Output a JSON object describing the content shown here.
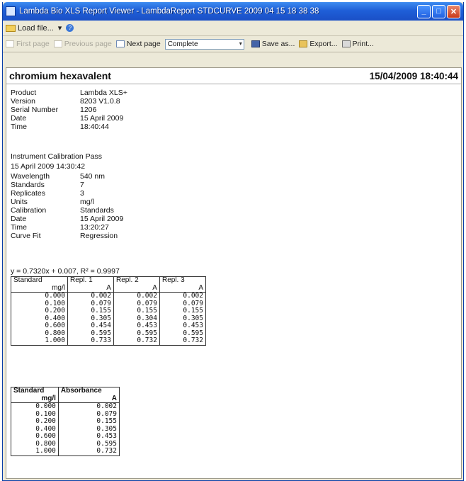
{
  "window": {
    "title": "Lambda Bio XLS Report Viewer - LambdaReport STDCURVE 2009 04 15 18 38 38",
    "min_glyph": "_",
    "max_glyph": "□",
    "close_glyph": "✕"
  },
  "menubar": {
    "load_file": "Load file...",
    "dropdown_glyph": "▾",
    "help_glyph": "?"
  },
  "toolbar": {
    "first_page": "First page",
    "previous_page": "Previous page",
    "next_page": "Next page",
    "zoom_value": "Complete",
    "select_arrow": "▾",
    "save_as": "Save as...",
    "export": "Export...",
    "print": "Print..."
  },
  "report": {
    "title": "chromium hexavalent",
    "datetime": "15/04/2009 18:40:44",
    "info": [
      {
        "k": "Product",
        "v": "Lambda XLS+"
      },
      {
        "k": "Version",
        "v": "8203 V1.0.8"
      },
      {
        "k": "Serial Number",
        "v": "1206"
      },
      {
        "k": "Date",
        "v": "15 April 2009"
      },
      {
        "k": "Time",
        "v": "18:40:44"
      }
    ],
    "calibration_heading": "Instrument Calibration Pass",
    "calibration_datetime": "15 April 2009 14:30:42",
    "calibration": [
      {
        "k": "Wavelength",
        "v": "540 nm"
      },
      {
        "k": "Standards",
        "v": "7"
      },
      {
        "k": "Replicates",
        "v": "3"
      },
      {
        "k": "Units",
        "v": "mg/l"
      },
      {
        "k": "Calibration",
        "v": "Standards"
      },
      {
        "k": "Date",
        "v": "15 April 2009"
      },
      {
        "k": "Time",
        "v": "13:20:27"
      },
      {
        "k": "Curve Fit",
        "v": "Regression"
      }
    ],
    "equation": "y = 0.7320x + 0.007, R² = 0.9997",
    "replicate_table": {
      "headers": [
        {
          "label": "Standard",
          "unit": "mg/l"
        },
        {
          "label": "Repl. 1",
          "unit": "A"
        },
        {
          "label": "Repl. 2",
          "unit": "A"
        },
        {
          "label": "Repl. 3",
          "unit": "A"
        }
      ],
      "rows": [
        [
          "0.000",
          "0.002",
          "0.002",
          "0.002"
        ],
        [
          "0.100",
          "0.079",
          "0.079",
          "0.079"
        ],
        [
          "0.200",
          "0.155",
          "0.155",
          "0.155"
        ],
        [
          "0.400",
          "0.305",
          "0.304",
          "0.305"
        ],
        [
          "0.600",
          "0.454",
          "0.453",
          "0.453"
        ],
        [
          "0.800",
          "0.595",
          "0.595",
          "0.595"
        ],
        [
          "1.000",
          "0.733",
          "0.732",
          "0.732"
        ]
      ]
    },
    "absorbance_table": {
      "headers": [
        {
          "label": "Standard",
          "unit": "mg/l"
        },
        {
          "label": "Absorbance",
          "unit": "A"
        }
      ],
      "rows": [
        [
          "0.000",
          "0.002"
        ],
        [
          "0.100",
          "0.079"
        ],
        [
          "0.200",
          "0.155"
        ],
        [
          "0.400",
          "0.305"
        ],
        [
          "0.600",
          "0.453"
        ],
        [
          "0.800",
          "0.595"
        ],
        [
          "1.000",
          "0.732"
        ]
      ]
    }
  }
}
